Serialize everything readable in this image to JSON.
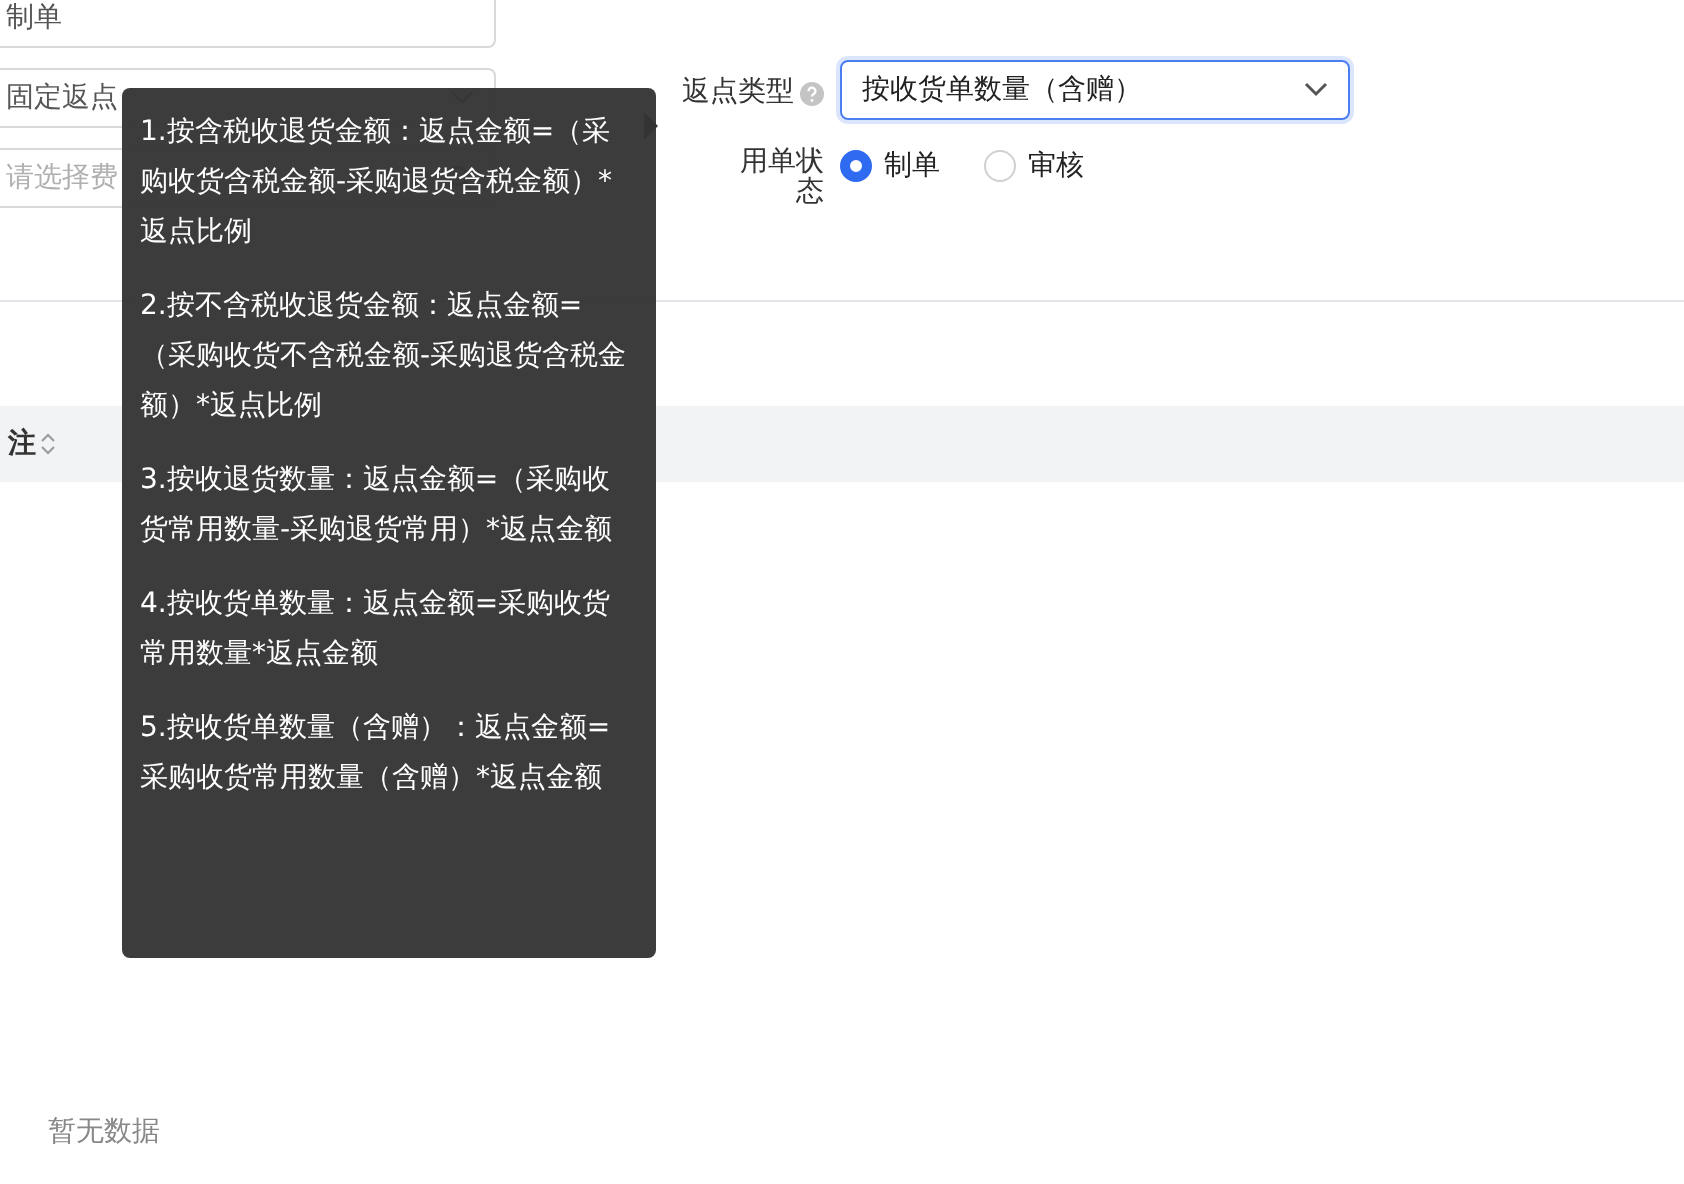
{
  "left_fields": [
    {
      "kind": "input",
      "value": "制单"
    },
    {
      "kind": "select",
      "value": "固定返点"
    },
    {
      "kind": "search",
      "placeholder": "请选择费"
    }
  ],
  "rebate_type": {
    "label": "返点类型",
    "value": "按收货单数量（含赠）"
  },
  "status": {
    "label": "用单状态",
    "options": [
      {
        "label": "制单",
        "selected": true
      },
      {
        "label": "审核",
        "selected": false
      }
    ]
  },
  "table": {
    "columns": [
      "注"
    ],
    "empty_text": "暂无数据"
  },
  "tooltip": [
    "1.按含税收退货金额：返点金额=（采购收货含税金额-采购退货含税金额）*返点比例",
    "2.按不含税收退货金额：返点金额=（采购收货不含税金额-采购退货含税金额）*返点比例",
    "3.按收退货数量：返点金额=（采购收货常用数量-采购退货常用）*返点金额",
    "4.按收货单数量：返点金额=采购收货常用数量*返点金额",
    "5.按收货单数量（含赠）：返点金额=采购收货常用数量（含赠）*返点金额"
  ]
}
